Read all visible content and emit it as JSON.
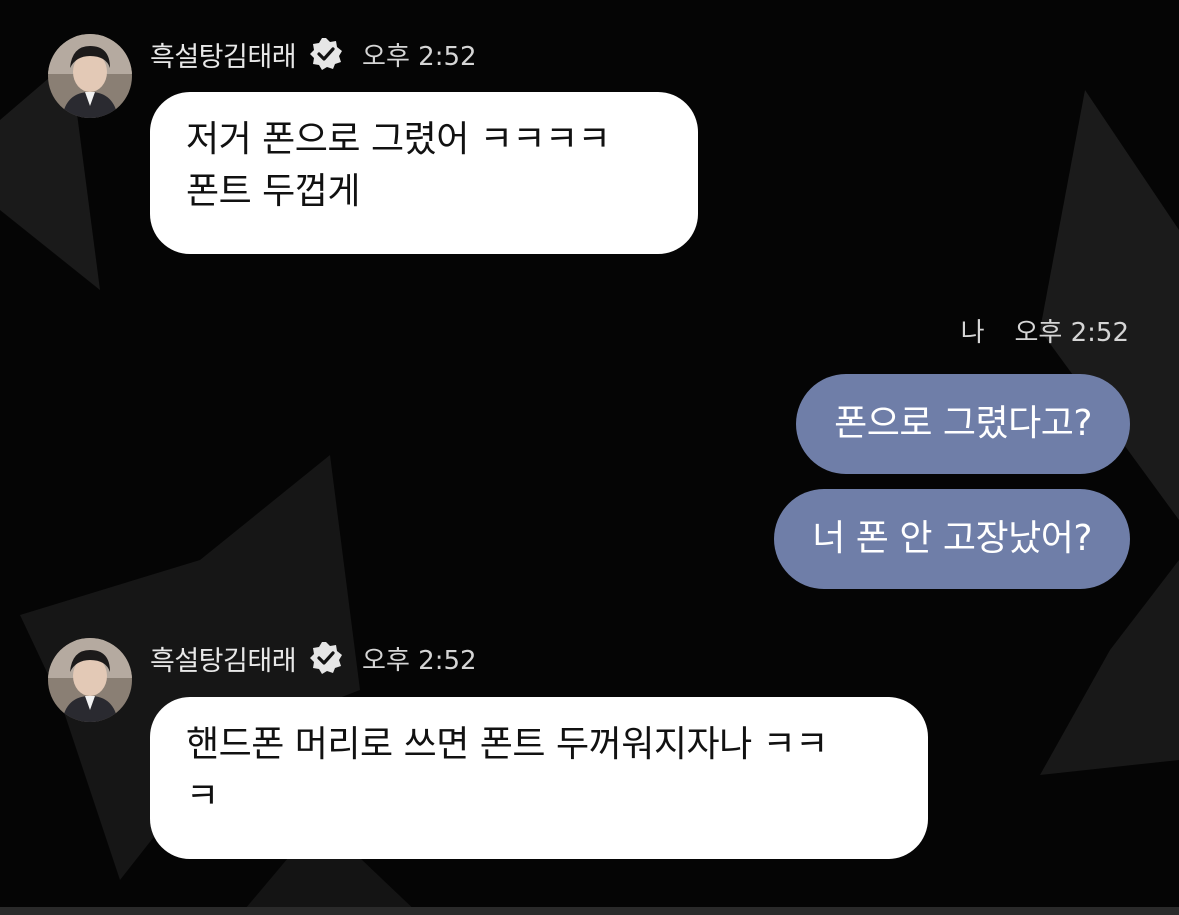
{
  "messages": [
    {
      "sender": "흑설탕김태래",
      "time": "오후 2:52",
      "lines": [
        "저거 폰으로 그렸어 ㅋㅋㅋㅋ",
        "폰트 두껍게"
      ]
    },
    {
      "me_label": "나",
      "time": "오후 2:52",
      "texts": [
        "폰으로 그렸다고?",
        "너 폰 안 고장났어?"
      ]
    },
    {
      "sender": "흑설탕김태래",
      "time": "오후 2:52",
      "lines": [
        "핸드폰 머리로 쓰면 폰트 두꺼워지자나 ㅋㅋ",
        "ㅋ"
      ]
    }
  ],
  "colors": {
    "background": "#050505",
    "received_bubble": "#ffffff",
    "sent_bubble": "#6f7ea8"
  },
  "icons": [
    "verified-badge-icon",
    "avatar"
  ]
}
